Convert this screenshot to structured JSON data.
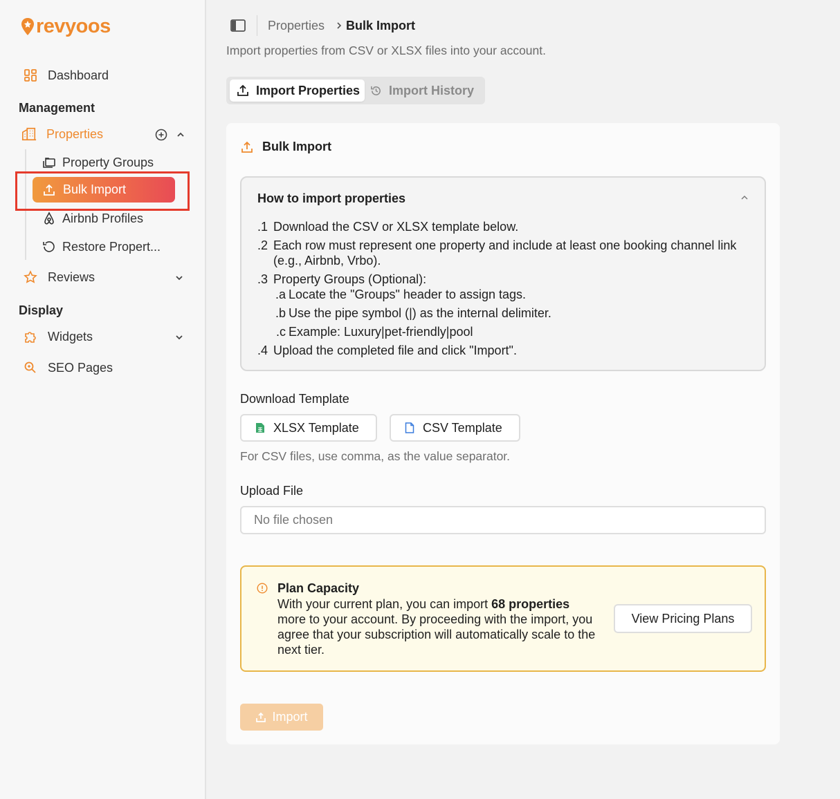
{
  "brand": {
    "name": "revyoos",
    "color": "#ef8a2e"
  },
  "sidebar": {
    "dashboard_label": "Dashboard",
    "section_management": "Management",
    "properties_label": "Properties",
    "property_groups_label": "Property Groups",
    "bulk_import_label": "Bulk Import",
    "airbnb_profiles_label": "Airbnb Profiles",
    "restore_label": "Restore Propert...",
    "reviews_label": "Reviews",
    "section_display": "Display",
    "widgets_label": "Widgets",
    "seo_pages_label": "SEO Pages"
  },
  "breadcrumb": {
    "parent": "Properties",
    "current": "Bulk Import"
  },
  "page": {
    "subtitle": "Import properties from CSV or XLSX files into your account."
  },
  "tabs": [
    {
      "label": "Import Properties",
      "active": true
    },
    {
      "label": "Import History",
      "active": false
    }
  ],
  "card": {
    "title": "Bulk Import",
    "howto": {
      "title": "How to import properties",
      "steps": [
        {
          "num": "1.",
          "text": "Download the CSV or XLSX template below."
        },
        {
          "num": "2.",
          "text": "Each row must represent one property and include at least one booking channel link (e.g., Airbnb, Vrbo)."
        },
        {
          "num": "3.",
          "text": "Property Groups (Optional):"
        },
        {
          "num": "4.",
          "text": "Upload the completed file and click \"Import\"."
        }
      ],
      "substeps": [
        {
          "num": "a.",
          "text": "Locate the \"Groups\" header to assign tags."
        },
        {
          "num": "b.",
          "text": "Use the pipe symbol (|) as the internal delimiter."
        },
        {
          "num": "c.",
          "text": "Example: Luxury|pet-friendly|pool"
        }
      ]
    },
    "download_label": "Download Template",
    "xlsx_button": "XLSX Template",
    "csv_button": "CSV Template",
    "csv_hint": "For CSV files, use comma, as the value separator.",
    "upload_label": "Upload File",
    "file_placeholder": "No file chosen",
    "plan": {
      "title": "Plan Capacity",
      "text_before": "With your current plan, you can import ",
      "text_bold": "68 properties",
      "text_after": " more to your account. By proceeding with the import, you agree that your subscription will automatically scale to the next tier.",
      "button": "View Pricing Plans"
    },
    "import_button": "Import"
  },
  "colors": {
    "accent": "#ef8a2e",
    "active_gradient_end": "#e84c55",
    "warning_border": "#e8b64a"
  }
}
